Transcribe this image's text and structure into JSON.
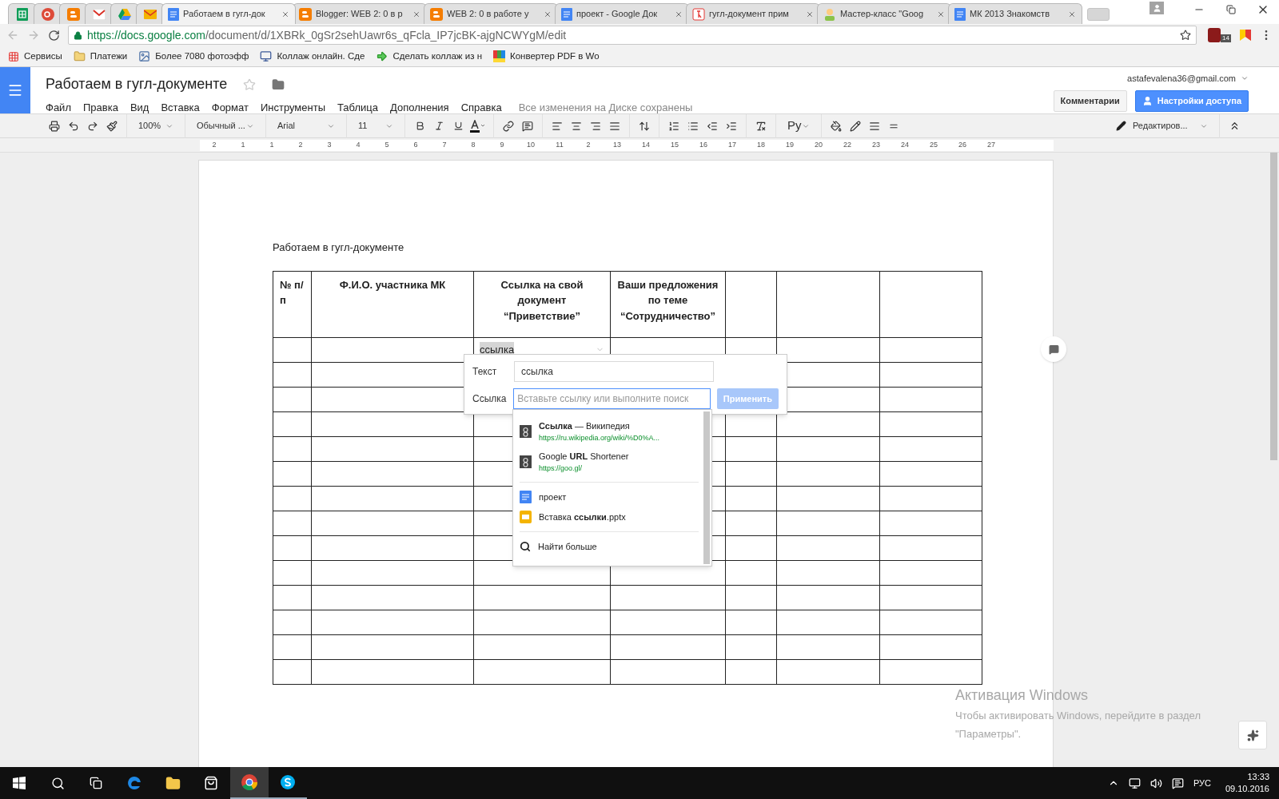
{
  "browser": {
    "tabs": [
      {
        "selected": false
      },
      {
        "selected": false
      },
      {
        "selected": false
      },
      {
        "selected": false
      },
      {
        "selected": false
      },
      {
        "selected": false
      },
      {
        "title": "Работаем в гугл-док",
        "selected": true
      },
      {
        "title": "Blogger: WEB 2: 0 в р",
        "selected": false
      },
      {
        "title": "WEB 2: 0 в работе у",
        "selected": false
      },
      {
        "title": "проект - Google Док",
        "selected": false
      },
      {
        "title": "гугл-документ прим",
        "selected": false
      },
      {
        "title": "Мастер-класс \"Goog",
        "selected": false
      },
      {
        "title": "МК 2013 Знакомств",
        "selected": false
      }
    ],
    "url_host": "https://docs.google.com",
    "url_path": "/document/d/1XBRk_0gSr2sehUawr6s_qFcla_IP7jcBK-ajgNCWYgM/edit",
    "extension_badge": "14",
    "bookmarks": [
      "Сервисы",
      "Платежи",
      "Более 7080 фотоэфф",
      "Коллаж онлайн. Сде",
      "Сделать коллаж из н",
      "Конвертер PDF в Wo"
    ]
  },
  "docs": {
    "title": "Работаем в гугл-документе",
    "account": "astafevalena36@gmail.com",
    "menu": [
      "Файл",
      "Правка",
      "Вид",
      "Вставка",
      "Формат",
      "Инструменты",
      "Таблица",
      "Дополнения",
      "Справка"
    ],
    "save_status": "Все изменения на Диске сохранены",
    "comments_button": "Комментарии",
    "share_button": "Настройки доступа",
    "toolbar": {
      "zoom": "100%",
      "style": "Обычный ...",
      "font": "Arial",
      "size": "11",
      "input_tools": "Ру",
      "mode": "Редактиров..."
    },
    "ruler": [
      "2",
      "1",
      "1",
      "2",
      "3",
      "4",
      "5",
      "6",
      "7",
      "8",
      "9",
      "10",
      "11",
      "2",
      "13",
      "14",
      "15",
      "16",
      "17",
      "18",
      "19",
      "20",
      "22",
      "23",
      "24",
      "25",
      "26",
      "27"
    ]
  },
  "document": {
    "heading": "Работаем в гугл-документе",
    "table": {
      "columns": [
        "№ п/п",
        "Ф.И.О. участника МК",
        "Ссылка на свой документ “Приветствие”",
        "Ваши предложения по теме “Сотрудничество”"
      ],
      "rows": [
        [
          "",
          "",
          "ссылка",
          "",
          "",
          "",
          ""
        ],
        [
          "",
          "",
          "",
          "",
          "",
          "",
          ""
        ],
        [
          "",
          "",
          "",
          "",
          "",
          "",
          ""
        ],
        [
          "",
          "",
          "",
          "",
          "",
          "",
          ""
        ],
        [
          "",
          "",
          "",
          "",
          "",
          "",
          ""
        ],
        [
          "",
          "",
          "",
          "",
          "",
          "",
          ""
        ],
        [
          "",
          "",
          "",
          "",
          "",
          "",
          ""
        ],
        [
          "",
          "",
          "",
          "",
          "",
          "",
          ""
        ],
        [
          "",
          "",
          "",
          "",
          "",
          "",
          ""
        ],
        [
          "",
          "",
          "",
          "",
          "",
          "",
          ""
        ],
        [
          "",
          "",
          "",
          "",
          "",
          "",
          ""
        ],
        [
          "",
          "",
          "",
          "",
          "",
          "",
          ""
        ],
        [
          "",
          "",
          "",
          "",
          "",
          "",
          ""
        ],
        [
          "",
          "",
          "",
          "",
          "",
          "",
          ""
        ]
      ]
    }
  },
  "link_popup": {
    "text_label": "Текст",
    "text_value": "ссылка",
    "link_label": "Ссылка",
    "link_placeholder": "Вставьте ссылку или выполните поиск",
    "apply": "Применить",
    "apply_disabled": true,
    "suggestions": [
      {
        "kind": "web",
        "title": "**Ссылка** — Википедия",
        "url": "https://ru.wikipedia.org/wiki/%D0%A..."
      },
      {
        "kind": "web",
        "title": "Google **URL** Shortener",
        "url": "https://goo.gl/"
      },
      {
        "kind": "doc",
        "title": "проект"
      },
      {
        "kind": "slides",
        "title": "Вставка **ссылки**.pptx"
      },
      {
        "kind": "search",
        "title": "Найти больше"
      }
    ]
  },
  "activation": {
    "title": "Активация Windows",
    "line_1": "Чтобы активировать Windows, перейдите в раздел",
    "line_2": "\"Параметры\"."
  },
  "taskbar": {
    "language": "РУС",
    "time": "13:33",
    "date": "09.10.2016"
  }
}
